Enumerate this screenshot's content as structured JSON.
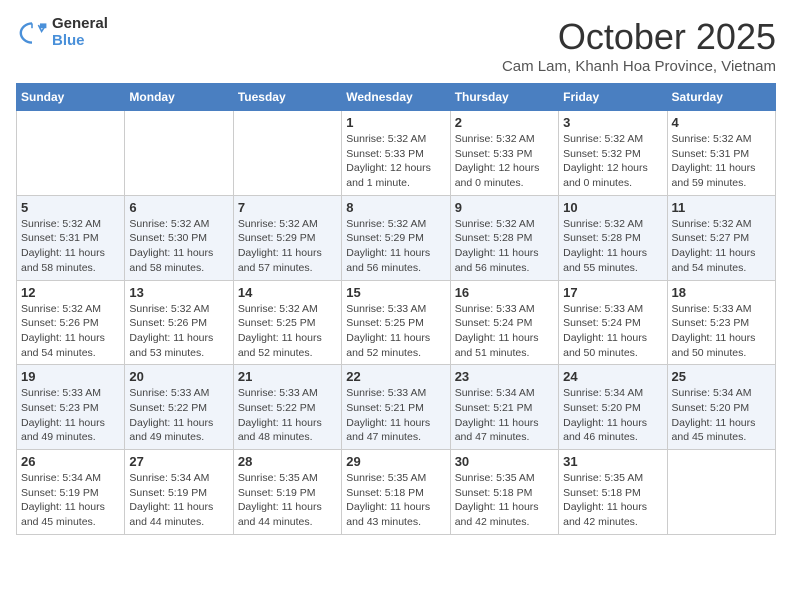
{
  "logo": {
    "general": "General",
    "blue": "Blue"
  },
  "title": "October 2025",
  "location": "Cam Lam, Khanh Hoa Province, Vietnam",
  "headers": [
    "Sunday",
    "Monday",
    "Tuesday",
    "Wednesday",
    "Thursday",
    "Friday",
    "Saturday"
  ],
  "weeks": [
    [
      {
        "day": "",
        "info": ""
      },
      {
        "day": "",
        "info": ""
      },
      {
        "day": "",
        "info": ""
      },
      {
        "day": "1",
        "info": "Sunrise: 5:32 AM\nSunset: 5:33 PM\nDaylight: 12 hours\nand 1 minute."
      },
      {
        "day": "2",
        "info": "Sunrise: 5:32 AM\nSunset: 5:33 PM\nDaylight: 12 hours\nand 0 minutes."
      },
      {
        "day": "3",
        "info": "Sunrise: 5:32 AM\nSunset: 5:32 PM\nDaylight: 12 hours\nand 0 minutes."
      },
      {
        "day": "4",
        "info": "Sunrise: 5:32 AM\nSunset: 5:31 PM\nDaylight: 11 hours\nand 59 minutes."
      }
    ],
    [
      {
        "day": "5",
        "info": "Sunrise: 5:32 AM\nSunset: 5:31 PM\nDaylight: 11 hours\nand 58 minutes."
      },
      {
        "day": "6",
        "info": "Sunrise: 5:32 AM\nSunset: 5:30 PM\nDaylight: 11 hours\nand 58 minutes."
      },
      {
        "day": "7",
        "info": "Sunrise: 5:32 AM\nSunset: 5:29 PM\nDaylight: 11 hours\nand 57 minutes."
      },
      {
        "day": "8",
        "info": "Sunrise: 5:32 AM\nSunset: 5:29 PM\nDaylight: 11 hours\nand 56 minutes."
      },
      {
        "day": "9",
        "info": "Sunrise: 5:32 AM\nSunset: 5:28 PM\nDaylight: 11 hours\nand 56 minutes."
      },
      {
        "day": "10",
        "info": "Sunrise: 5:32 AM\nSunset: 5:28 PM\nDaylight: 11 hours\nand 55 minutes."
      },
      {
        "day": "11",
        "info": "Sunrise: 5:32 AM\nSunset: 5:27 PM\nDaylight: 11 hours\nand 54 minutes."
      }
    ],
    [
      {
        "day": "12",
        "info": "Sunrise: 5:32 AM\nSunset: 5:26 PM\nDaylight: 11 hours\nand 54 minutes."
      },
      {
        "day": "13",
        "info": "Sunrise: 5:32 AM\nSunset: 5:26 PM\nDaylight: 11 hours\nand 53 minutes."
      },
      {
        "day": "14",
        "info": "Sunrise: 5:32 AM\nSunset: 5:25 PM\nDaylight: 11 hours\nand 52 minutes."
      },
      {
        "day": "15",
        "info": "Sunrise: 5:33 AM\nSunset: 5:25 PM\nDaylight: 11 hours\nand 52 minutes."
      },
      {
        "day": "16",
        "info": "Sunrise: 5:33 AM\nSunset: 5:24 PM\nDaylight: 11 hours\nand 51 minutes."
      },
      {
        "day": "17",
        "info": "Sunrise: 5:33 AM\nSunset: 5:24 PM\nDaylight: 11 hours\nand 50 minutes."
      },
      {
        "day": "18",
        "info": "Sunrise: 5:33 AM\nSunset: 5:23 PM\nDaylight: 11 hours\nand 50 minutes."
      }
    ],
    [
      {
        "day": "19",
        "info": "Sunrise: 5:33 AM\nSunset: 5:23 PM\nDaylight: 11 hours\nand 49 minutes."
      },
      {
        "day": "20",
        "info": "Sunrise: 5:33 AM\nSunset: 5:22 PM\nDaylight: 11 hours\nand 49 minutes."
      },
      {
        "day": "21",
        "info": "Sunrise: 5:33 AM\nSunset: 5:22 PM\nDaylight: 11 hours\nand 48 minutes."
      },
      {
        "day": "22",
        "info": "Sunrise: 5:33 AM\nSunset: 5:21 PM\nDaylight: 11 hours\nand 47 minutes."
      },
      {
        "day": "23",
        "info": "Sunrise: 5:34 AM\nSunset: 5:21 PM\nDaylight: 11 hours\nand 47 minutes."
      },
      {
        "day": "24",
        "info": "Sunrise: 5:34 AM\nSunset: 5:20 PM\nDaylight: 11 hours\nand 46 minutes."
      },
      {
        "day": "25",
        "info": "Sunrise: 5:34 AM\nSunset: 5:20 PM\nDaylight: 11 hours\nand 45 minutes."
      }
    ],
    [
      {
        "day": "26",
        "info": "Sunrise: 5:34 AM\nSunset: 5:19 PM\nDaylight: 11 hours\nand 45 minutes."
      },
      {
        "day": "27",
        "info": "Sunrise: 5:34 AM\nSunset: 5:19 PM\nDaylight: 11 hours\nand 44 minutes."
      },
      {
        "day": "28",
        "info": "Sunrise: 5:35 AM\nSunset: 5:19 PM\nDaylight: 11 hours\nand 44 minutes."
      },
      {
        "day": "29",
        "info": "Sunrise: 5:35 AM\nSunset: 5:18 PM\nDaylight: 11 hours\nand 43 minutes."
      },
      {
        "day": "30",
        "info": "Sunrise: 5:35 AM\nSunset: 5:18 PM\nDaylight: 11 hours\nand 42 minutes."
      },
      {
        "day": "31",
        "info": "Sunrise: 5:35 AM\nSunset: 5:18 PM\nDaylight: 11 hours\nand 42 minutes."
      },
      {
        "day": "",
        "info": ""
      }
    ]
  ]
}
